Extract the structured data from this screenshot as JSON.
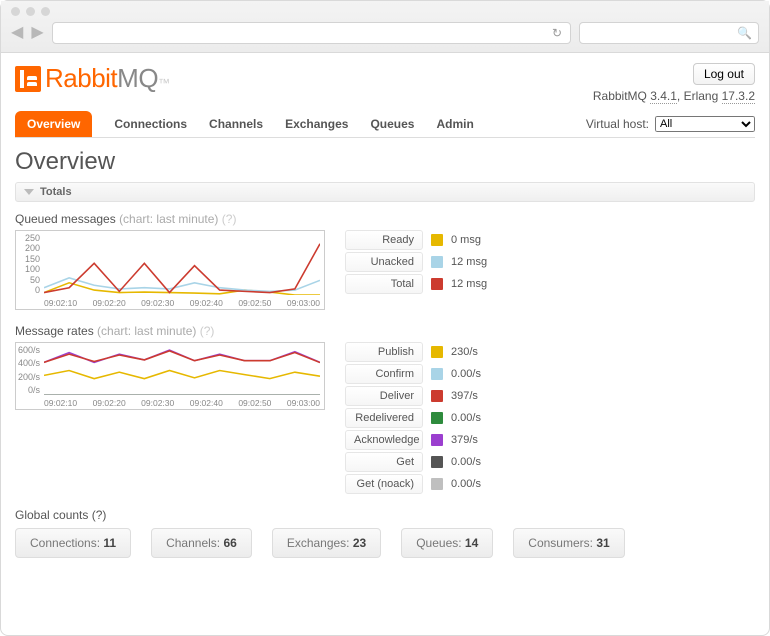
{
  "chrome": {
    "refresh_glyph": "↻",
    "search_glyph": "🔍"
  },
  "header": {
    "logo_prefix": "Rabbit",
    "logo_suffix": "MQ",
    "logout": "Log out",
    "version_prefix": "RabbitMQ ",
    "version_rabbit": "3.4.1",
    "version_mid": ", Erlang ",
    "version_erlang": "17.3.2"
  },
  "tabs": [
    "Overview",
    "Connections",
    "Channels",
    "Exchanges",
    "Queues",
    "Admin"
  ],
  "vhost": {
    "label": "Virtual host:",
    "selected": "All"
  },
  "page_title": "Overview",
  "section_totals": "Totals",
  "queued": {
    "title": "Queued messages ",
    "sub": "(chart: last minute)",
    "q": " (?)",
    "legend": [
      {
        "label": "Ready",
        "color": "#e6b800",
        "value": "0 msg"
      },
      {
        "label": "Unacked",
        "color": "#a9d4e7",
        "value": "12 msg"
      },
      {
        "label": "Total",
        "color": "#cc3b2f",
        "value": "12 msg"
      }
    ]
  },
  "rates": {
    "title": "Message rates ",
    "sub": "(chart: last minute)",
    "q": " (?)",
    "legend": [
      {
        "label": "Publish",
        "color": "#e6b800",
        "value": "230/s"
      },
      {
        "label": "Confirm",
        "color": "#a9d4e7",
        "value": "0.00/s"
      },
      {
        "label": "Deliver",
        "color": "#cc3b2f",
        "value": "397/s"
      },
      {
        "label": "Redelivered",
        "color": "#2e8b3d",
        "value": "0.00/s"
      },
      {
        "label": "Acknowledge",
        "color": "#9b3fcf",
        "value": "379/s"
      },
      {
        "label": "Get",
        "color": "#555555",
        "value": "0.00/s"
      },
      {
        "label": "Get (noack)",
        "color": "#bfbfbf",
        "value": "0.00/s"
      }
    ]
  },
  "global": {
    "title": "Global counts ",
    "q": "(?)",
    "items": [
      {
        "label": "Connections:",
        "value": "11"
      },
      {
        "label": "Channels:",
        "value": "66"
      },
      {
        "label": "Exchanges:",
        "value": "23"
      },
      {
        "label": "Queues:",
        "value": "14"
      },
      {
        "label": "Consumers:",
        "value": "31"
      }
    ]
  },
  "chart_data": [
    {
      "type": "line",
      "title": "Queued messages (last minute)",
      "x": [
        "09:02:10",
        "09:02:20",
        "09:02:30",
        "09:02:40",
        "09:02:50",
        "09:03:00"
      ],
      "ylim": [
        0,
        250
      ],
      "ylabel": "messages",
      "y_ticks": [
        0,
        50,
        100,
        150,
        200,
        250
      ],
      "series": [
        {
          "name": "Ready",
          "color": "#e6b800",
          "values": [
            10,
            50,
            20,
            10,
            12,
            10,
            8,
            5,
            20,
            12,
            0,
            0
          ]
        },
        {
          "name": "Unacked",
          "color": "#a9d4e7",
          "values": [
            30,
            70,
            40,
            25,
            30,
            25,
            50,
            30,
            20,
            15,
            20,
            60
          ]
        },
        {
          "name": "Total",
          "color": "#cc3b2f",
          "values": [
            10,
            30,
            130,
            15,
            130,
            10,
            120,
            20,
            15,
            10,
            25,
            210
          ]
        }
      ]
    },
    {
      "type": "line",
      "title": "Message rates (last minute)",
      "x": [
        "09:02:10",
        "09:02:20",
        "09:02:30",
        "09:02:40",
        "09:02:50",
        "09:03:00"
      ],
      "ylim": [
        0,
        600
      ],
      "ylabel": "per second",
      "y_ticks": [
        0,
        200,
        400,
        600
      ],
      "series": [
        {
          "name": "Publish",
          "color": "#e6b800",
          "values": [
            240,
            300,
            200,
            280,
            200,
            300,
            210,
            300,
            250,
            200,
            280,
            230
          ]
        },
        {
          "name": "Acknowledge",
          "color": "#9b3fcf",
          "values": [
            400,
            520,
            400,
            500,
            430,
            550,
            420,
            500,
            420,
            420,
            530,
            400
          ]
        },
        {
          "name": "Confirm",
          "color": "#a9d4e7",
          "values": [
            0,
            0,
            0,
            0,
            0,
            0,
            0,
            0,
            0,
            0,
            0,
            0
          ]
        },
        {
          "name": "Deliver",
          "color": "#cc3b2f",
          "values": [
            400,
            500,
            410,
            490,
            430,
            540,
            420,
            490,
            420,
            420,
            520,
            397
          ]
        },
        {
          "name": "Redelivered",
          "color": "#2e8b3d",
          "values": [
            0,
            0,
            0,
            0,
            0,
            0,
            0,
            0,
            0,
            0,
            0,
            0
          ]
        },
        {
          "name": "Get",
          "color": "#555555",
          "values": [
            0,
            0,
            0,
            0,
            0,
            0,
            0,
            0,
            0,
            0,
            0,
            0
          ]
        },
        {
          "name": "Get (noack)",
          "color": "#bfbfbf",
          "values": [
            0,
            0,
            0,
            0,
            0,
            0,
            0,
            0,
            0,
            0,
            0,
            0
          ]
        }
      ]
    }
  ]
}
